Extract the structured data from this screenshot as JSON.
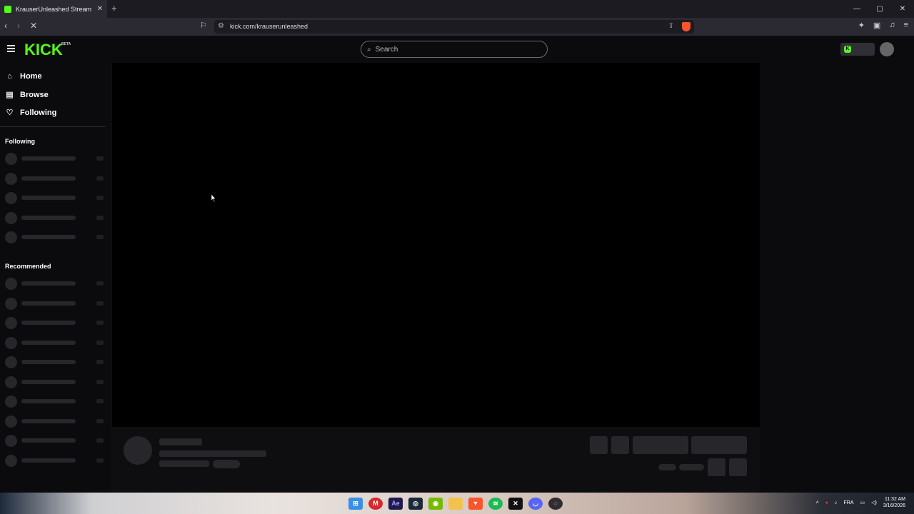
{
  "browser": {
    "tab_title": "KrauserUnleashed Stream - Wat...",
    "tab_close": "✕",
    "new_tab": "+",
    "url": "kick.com/krauserunleashed",
    "window_controls": [
      "—",
      "▢",
      "✕"
    ]
  },
  "kick": {
    "logo": "KICK",
    "beta": "BETA",
    "search_placeholder": "Search",
    "nav": [
      {
        "label": "Home",
        "icon": "home-icon"
      },
      {
        "label": "Browse",
        "icon": "browse-icon"
      },
      {
        "label": "Following",
        "icon": "heart-icon"
      }
    ],
    "sections": {
      "following": "Following",
      "recommended": "Recommended"
    },
    "accent": "#53fc18"
  },
  "taskbar": {
    "apps": [
      "windows-start-icon",
      "mega-icon",
      "after-effects-icon",
      "steam-icon",
      "nvidia-icon",
      "file-explorer-icon",
      "brave-icon",
      "spotify-icon",
      "capcut-icon",
      "discord-icon",
      "obs-icon"
    ],
    "lang": "FRA",
    "time": "11:32 AM",
    "date": "3/16/2026"
  }
}
